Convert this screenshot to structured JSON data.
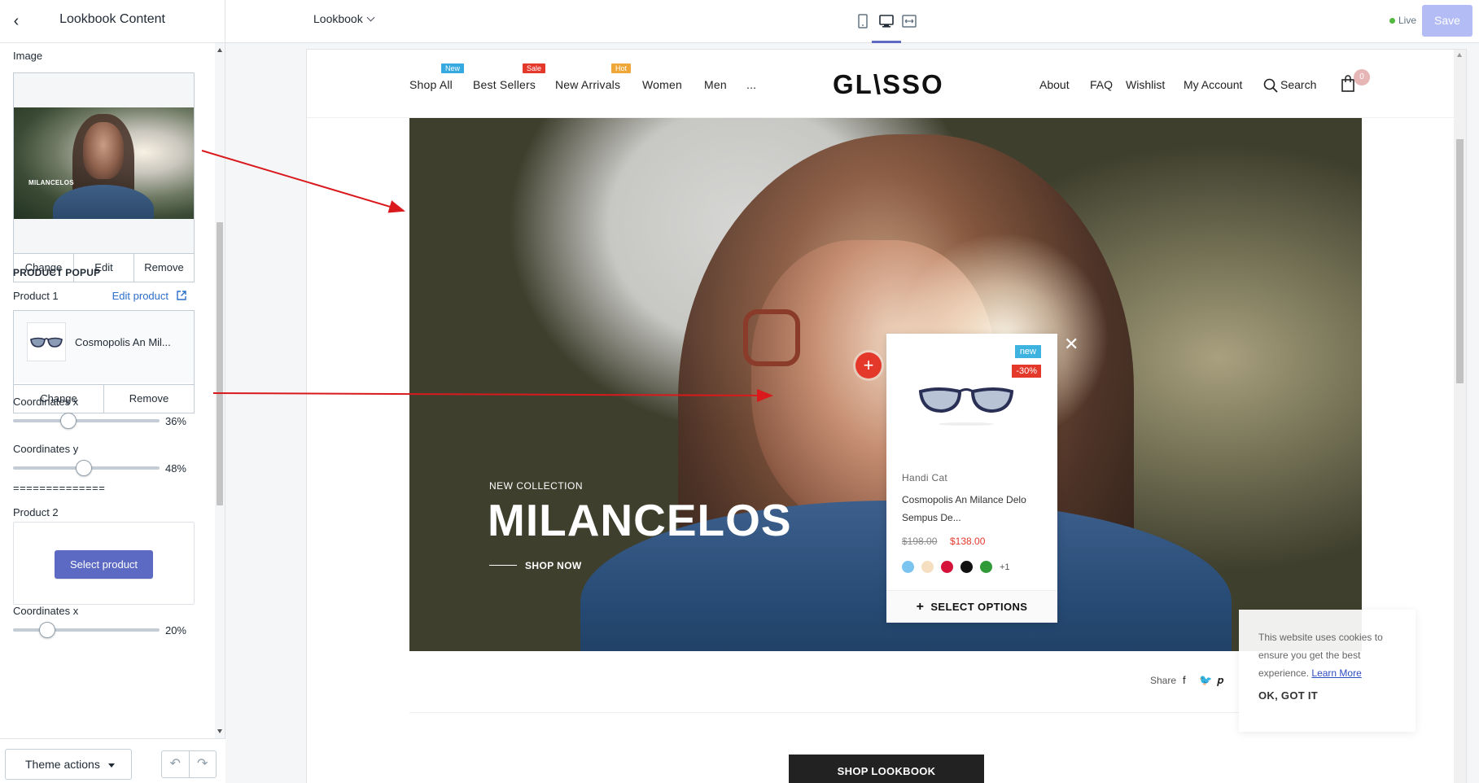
{
  "sidebar": {
    "title": "Lookbook Content",
    "image_label": "Image",
    "image_text": "MILANCELOS",
    "image_buttons": [
      "Change",
      "Edit",
      "Remove"
    ],
    "section_heading": "PRODUCT POPUP",
    "product1_label": "Product 1",
    "edit_product": "Edit product",
    "product1_name": "Cosmopolis An Mil...",
    "product1_buttons": [
      "Change",
      "Remove"
    ],
    "coord_x_label": "Coordinates x",
    "coord_x_value": "36%",
    "coord_x_level": 0.36,
    "coord_y_label": "Coordinates y",
    "coord_y_value": "48%",
    "coord_y_level": 0.48,
    "separator": "==============",
    "product2_label": "Product 2",
    "select_product": "Select product",
    "coord_x2_label": "Coordinates x",
    "coord_x2_value": "20%",
    "coord_x2_level": 0.2,
    "theme_actions": "Theme actions"
  },
  "topbar": {
    "page": "Lookbook",
    "live": "Live",
    "save": "Save"
  },
  "store": {
    "nav_left": [
      {
        "label": "Shop All",
        "badge": "New",
        "badge_color": "#35a9e0"
      },
      {
        "label": "Best Sellers",
        "badge": "Sale",
        "badge_color": "#e3382a"
      },
      {
        "label": "New Arrivals",
        "badge": "Hot",
        "badge_color": "#f0a73a"
      },
      {
        "label": "Women"
      },
      {
        "label": "Men"
      },
      {
        "label": "..."
      }
    ],
    "logo": "GL\\SSO",
    "nav_right": [
      "About",
      "FAQ",
      "Wishlist",
      "My Account",
      "Search"
    ],
    "cart_count": "0",
    "hero": {
      "tag": "NEW COLLECTION",
      "title": "MILANCELOS",
      "shop_now": "SHOP NOW"
    },
    "popup": {
      "badge_new": "new",
      "badge_off": "-30%",
      "vendor": "Handi Cat",
      "name": "Cosmopolis An Milance Delo Sempus De...",
      "old_price": "$198.00",
      "price": "$138.00",
      "swatches": [
        "#7cc4f0",
        "#f5dfc0",
        "#d4123a",
        "#111111",
        "#2f9a37"
      ],
      "more": "+1",
      "select_options": "SELECT OPTIONS"
    },
    "share": "Share",
    "shop_lookbook": "SHOP LOOKBOOK",
    "cookie": {
      "message": "This website uses cookies to ensure you get the best experience.",
      "learn_more": "Learn More",
      "ok": "OK, GOT IT"
    }
  },
  "colors": {
    "accent": "#5c6ac4",
    "hotspot": "#e3382a",
    "annotation_arrow": "#d9191c"
  }
}
